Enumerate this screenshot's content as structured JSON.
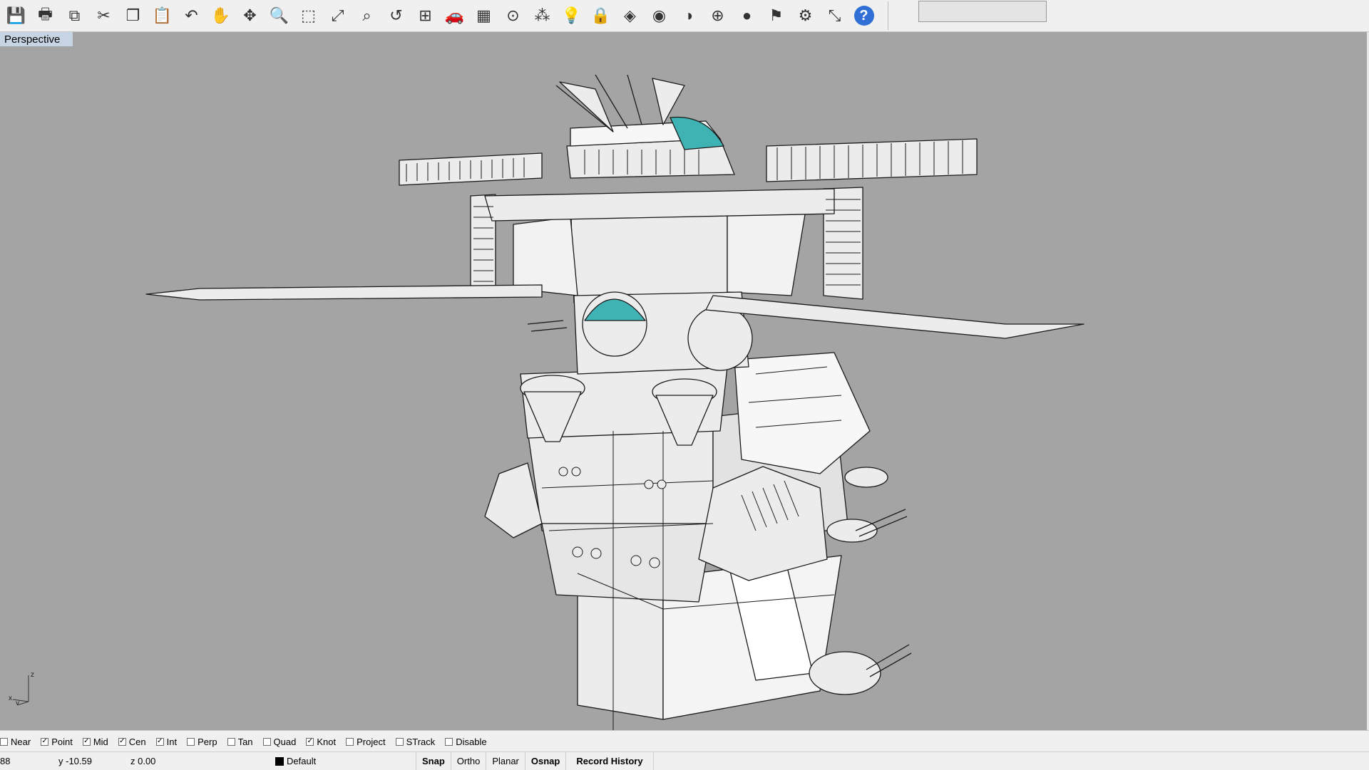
{
  "toolbar": {
    "buttons": [
      {
        "name": "save-icon",
        "glyph": "💾"
      },
      {
        "name": "print-icon",
        "glyph": "🖶"
      },
      {
        "name": "copy-to-clipboard-icon",
        "glyph": "⧉"
      },
      {
        "name": "cut-icon",
        "glyph": "✂"
      },
      {
        "name": "copy-icon",
        "glyph": "❐"
      },
      {
        "name": "paste-icon",
        "glyph": "📋"
      },
      {
        "name": "undo-icon",
        "glyph": "↶"
      },
      {
        "name": "pan-hand-icon",
        "glyph": "✋"
      },
      {
        "name": "rotate-view-icon",
        "glyph": "✥"
      },
      {
        "name": "zoom-dynamic-icon",
        "glyph": "🔍"
      },
      {
        "name": "zoom-window-icon",
        "glyph": "⬚"
      },
      {
        "name": "zoom-extents-icon",
        "glyph": "⤢"
      },
      {
        "name": "zoom-selected-icon",
        "glyph": "⌕"
      },
      {
        "name": "undo-view-change-icon",
        "glyph": "↺"
      },
      {
        "name": "four-viewports-icon",
        "glyph": "⊞"
      },
      {
        "name": "named-views-icon",
        "glyph": "🚗"
      },
      {
        "name": "construction-plane-icon",
        "glyph": "▦"
      },
      {
        "name": "osnap-icon",
        "glyph": "⊙"
      },
      {
        "name": "select-points-icon",
        "glyph": "⁂"
      },
      {
        "name": "lights-icon",
        "glyph": "💡"
      },
      {
        "name": "lock-icon",
        "glyph": "🔒"
      },
      {
        "name": "layer-icon",
        "glyph": "◈"
      },
      {
        "name": "color-wheel-icon",
        "glyph": "◉"
      },
      {
        "name": "shaded-sphere-icon",
        "glyph": "◑"
      },
      {
        "name": "wireframe-sphere-icon",
        "glyph": "⊕"
      },
      {
        "name": "render-sphere-icon",
        "glyph": "●"
      },
      {
        "name": "analyze-direction-icon",
        "glyph": "⚑"
      },
      {
        "name": "options-gear-icon",
        "glyph": "⚙"
      },
      {
        "name": "dimension-icon",
        "glyph": "⤡"
      },
      {
        "name": "help-icon",
        "glyph": "?"
      }
    ],
    "command_value": ""
  },
  "viewport": {
    "title": "Perspective",
    "colors": {
      "background": "#a4a4a4",
      "model_fill": "#ececec",
      "model_stroke": "#1a1a1a",
      "accent": "#3fb3b3"
    }
  },
  "axis": {
    "z": "z",
    "x": "x",
    "y": "y"
  },
  "osnap": [
    {
      "label": "Near",
      "checked": false
    },
    {
      "label": "Point",
      "checked": true
    },
    {
      "label": "Mid",
      "checked": true
    },
    {
      "label": "Cen",
      "checked": true
    },
    {
      "label": "Int",
      "checked": true
    },
    {
      "label": "Perp",
      "checked": false
    },
    {
      "label": "Tan",
      "checked": false
    },
    {
      "label": "Quad",
      "checked": false
    },
    {
      "label": "Knot",
      "checked": true
    },
    {
      "label": "Project",
      "checked": false
    },
    {
      "label": "STrack",
      "checked": false
    },
    {
      "label": "Disable",
      "checked": false
    }
  ],
  "status": {
    "x": "88",
    "y": "y -10.59",
    "z": "z 0.00",
    "layer": "Default",
    "snap": "Snap",
    "ortho": "Ortho",
    "planar": "Planar",
    "osnap": "Osnap",
    "record_history": "Record History"
  }
}
